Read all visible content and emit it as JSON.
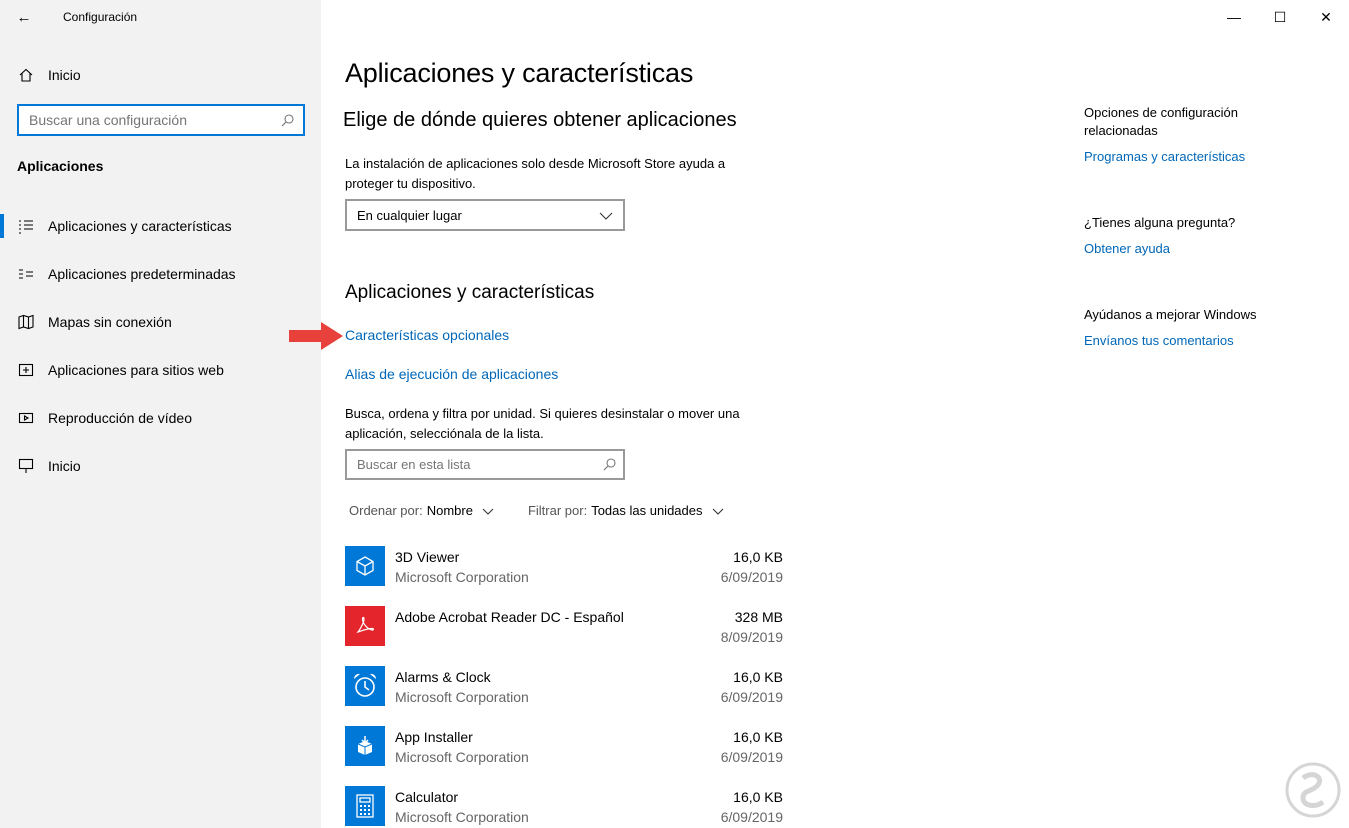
{
  "window": {
    "title": "Configuración",
    "back_icon": "←",
    "minimize_icon": "—",
    "maximize_icon": "☐",
    "close_icon": "✕"
  },
  "sidebar": {
    "home_label": "Inicio",
    "search_placeholder": "Buscar una configuración",
    "section_title": "Aplicaciones",
    "items": [
      {
        "label": "Aplicaciones y características",
        "icon": "apps-features-icon",
        "active": true
      },
      {
        "label": "Aplicaciones predeterminadas",
        "icon": "default-apps-icon",
        "active": false
      },
      {
        "label": "Mapas sin conexión",
        "icon": "offline-maps-icon",
        "active": false
      },
      {
        "label": "Aplicaciones para sitios web",
        "icon": "apps-websites-icon",
        "active": false
      },
      {
        "label": "Reproducción de vídeo",
        "icon": "video-playback-icon",
        "active": false
      },
      {
        "label": "Inicio",
        "icon": "startup-icon",
        "active": false
      }
    ]
  },
  "main": {
    "page_title": "Aplicaciones y características",
    "choose_title": "Elige de dónde quieres obtener aplicaciones",
    "choose_desc": "La instalación de aplicaciones solo desde Microsoft Store ayuda a proteger tu dispositivo.",
    "dropdown_value": "En cualquier lugar",
    "apps_title": "Aplicaciones y características",
    "link_optional": "Características opcionales",
    "link_alias": "Alias de ejecución de aplicaciones",
    "list_desc": "Busca, ordena y filtra por unidad. Si quieres desinstalar o mover una aplicación, selecciónala de la lista.",
    "list_search_placeholder": "Buscar en esta lista",
    "sort_key": "Ordenar por:",
    "sort_value": "Nombre",
    "filter_key": "Filtrar por:",
    "filter_value": "Todas las unidades",
    "apps": [
      {
        "name": "3D Viewer",
        "publisher": "Microsoft Corporation",
        "size": "16,0 KB",
        "date": "6/09/2019",
        "color": "#0078d7"
      },
      {
        "name": "Adobe Acrobat Reader DC - Español",
        "publisher": "",
        "size": "328 MB",
        "date": "8/09/2019",
        "color": "#e4262c"
      },
      {
        "name": "Alarms & Clock",
        "publisher": "Microsoft Corporation",
        "size": "16,0 KB",
        "date": "6/09/2019",
        "color": "#0078d7"
      },
      {
        "name": "App Installer",
        "publisher": "Microsoft Corporation",
        "size": "16,0 KB",
        "date": "6/09/2019",
        "color": "#0078d7"
      },
      {
        "name": "Calculator",
        "publisher": "Microsoft Corporation",
        "size": "16,0 KB",
        "date": "6/09/2019",
        "color": "#0078d7"
      }
    ]
  },
  "related": {
    "title": "Opciones de configuración relacionadas",
    "link": "Programas y características",
    "question_title": "¿Tienes alguna pregunta?",
    "question_link": "Obtener ayuda",
    "improve_title": "Ayúdanos a mejorar Windows",
    "improve_link": "Envíanos tus comentarios"
  },
  "colors": {
    "accent": "#0078d7",
    "link": "#0067b8",
    "arrow": "#e8403a"
  }
}
